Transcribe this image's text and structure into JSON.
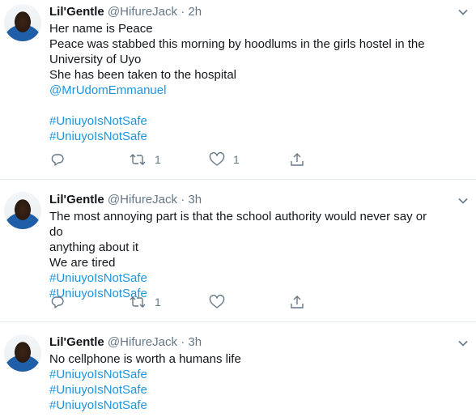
{
  "tweets": [
    {
      "name": "Lil'Gentle",
      "handle": "@HifureJack",
      "dot": "·",
      "time": "2h",
      "lines": [
        "Her name is Peace",
        "Peace was stabbed this morning by hoodlums in the girls hostel in the",
        "University of Uyo",
        "She has been taken to the hospital"
      ],
      "mention": "@MrUdomEmmanuel",
      "hashtags": [
        "#UniuyoIsNotSafe",
        "#UniuyoIsNotSafe"
      ],
      "retweets": "1",
      "likes": "1"
    },
    {
      "name": "Lil'Gentle",
      "handle": "@HifureJack",
      "dot": "·",
      "time": "3h",
      "lines": [
        "The most annoying part is that the school authority would never say or do",
        "anything about it",
        "We are tired"
      ],
      "hashtags": [
        "#UniuyoIsNotSafe",
        "#UniuyoIsNotSafe"
      ],
      "retweets": "1",
      "likes": ""
    },
    {
      "name": "Lil'Gentle",
      "handle": "@HifureJack",
      "dot": "·",
      "time": "3h",
      "lines": [
        "No cellphone is worth a humans life"
      ],
      "hashtags": [
        "#UniuyoIsNotSafe",
        "#UniuyoIsNotSafe",
        "#UniuyoIsNotSafe"
      ]
    }
  ],
  "icons": {
    "reply": "reply-icon",
    "retweet": "retweet-icon",
    "like": "heart-icon",
    "share": "share-icon",
    "more": "chevron-down-icon"
  },
  "colors": {
    "link": "#1b95e0",
    "muted": "#657786",
    "divider": "#e6ecf0"
  }
}
